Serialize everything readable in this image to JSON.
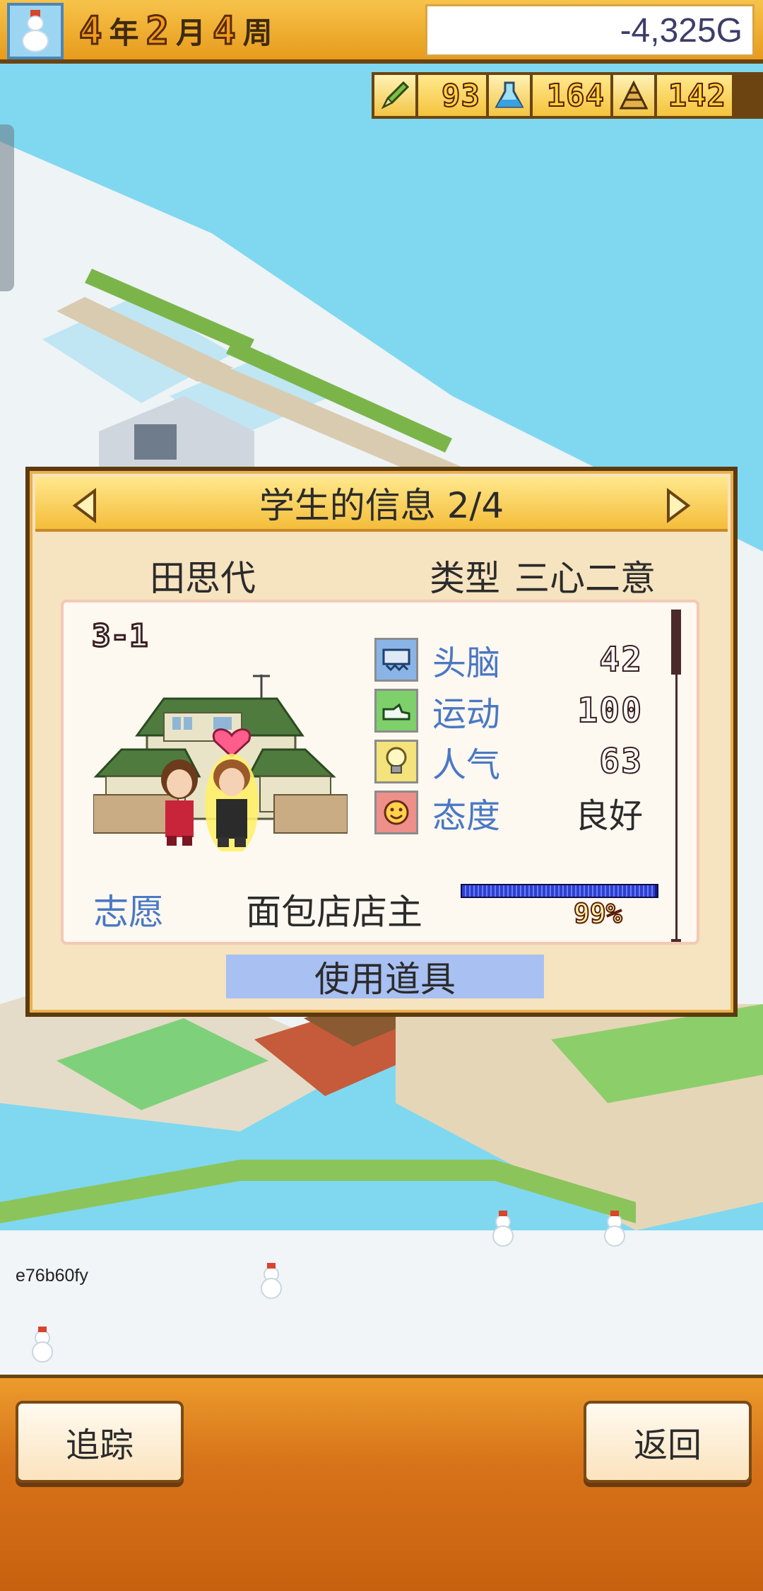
{
  "top_bar": {
    "season_icon": "snowman-icon",
    "date": {
      "year_num": "4",
      "year_unit": "年",
      "month_num": "2",
      "month_unit": "月",
      "week_num": "4",
      "week_unit": "周"
    },
    "money": "-4,325G"
  },
  "resources": [
    {
      "icon": "pencil-icon",
      "value": "93"
    },
    {
      "icon": "flask-icon",
      "value": "164"
    },
    {
      "icon": "pyramid-icon",
      "value": "142"
    }
  ],
  "dialog": {
    "title": "学生的信息 2/4",
    "student_name": "田思代",
    "type_label": "类型",
    "type_value": "三心二意",
    "class": "3-1",
    "stats": [
      {
        "icon": "brain-icon",
        "label": "头脑",
        "value": "42"
      },
      {
        "icon": "sneaker-icon",
        "label": "运动",
        "value": "100"
      },
      {
        "icon": "lightbulb-icon",
        "label": "人气",
        "value": "63"
      },
      {
        "icon": "smiley-icon",
        "label": "态度",
        "value": "良好"
      }
    ],
    "aspiration_label": "志愿",
    "aspiration_value": "面包店店主",
    "aspiration_percent": "99%",
    "aspiration_fraction": 0.99,
    "use_item_label": "使用道具"
  },
  "watermark": "e76b60fy",
  "bottom": {
    "track_label": "追踪",
    "back_label": "返回"
  },
  "colors": {
    "accent_gold": "#f4bd3a",
    "stat_label_blue": "#4a78c4",
    "button_blue": "#a8c0f2",
    "bar_orange": "#d7731a"
  }
}
